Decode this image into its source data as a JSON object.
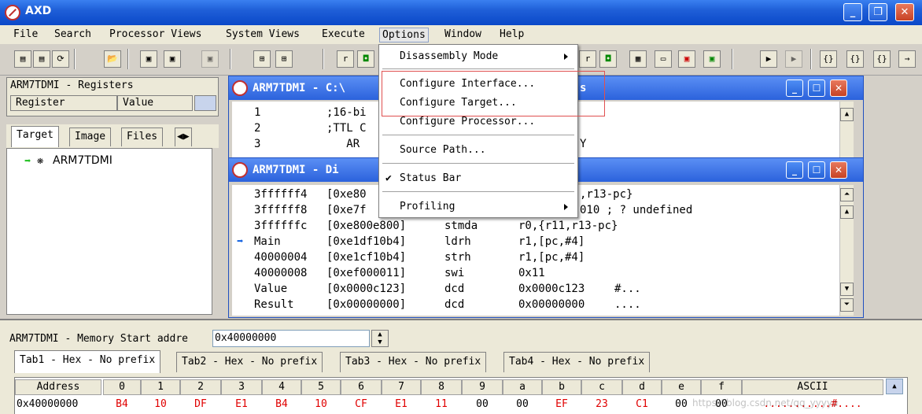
{
  "app": {
    "title": "AXD"
  },
  "menu": {
    "items": [
      "File",
      "Search",
      "Processor Views",
      "System Views",
      "Execute",
      "Options",
      "Window",
      "Help"
    ]
  },
  "registers": {
    "title": "ARM7TDMI - Registers",
    "col_register": "Register",
    "col_value": "Value"
  },
  "left_tabs": [
    "Target",
    "Image",
    "Files"
  ],
  "tree": {
    "root": "ARM7TDMI"
  },
  "source_window": {
    "title": "ARM7TDMI - C:\\",
    "title_tail": "s",
    "lines": [
      {
        "num": "1",
        "text": ";16-bi"
      },
      {
        "num": "2",
        "text": ";TTL C"
      },
      {
        "num": "3",
        "text": "   AR"
      }
    ],
    "tail": "Y"
  },
  "disasm_window": {
    "title": "ARM7TDMI - Di",
    "rows": [
      {
        "addr": "3ffffff4",
        "hex": "[0xe80",
        "op": "",
        "args": "",
        "tail": ",r13-pc}"
      },
      {
        "addr": "3ffffff8",
        "hex": "[0xe7f",
        "op": "",
        "args": "",
        "tail": "010 ; ? undefined"
      },
      {
        "addr": "3ffffffc",
        "hex": "[0xe800e800]",
        "op": "stmda",
        "args": "r0,{r11,r13-pc}",
        "tail": ""
      },
      {
        "addr": "Main",
        "hex": "[0xe1df10b4]",
        "op": "ldrh",
        "args": "r1,[pc,#4]",
        "tail": ""
      },
      {
        "addr": "40000004",
        "hex": "[0xe1cf10b4]",
        "op": "strh",
        "args": "r1,[pc,#4]",
        "tail": ""
      },
      {
        "addr": "40000008",
        "hex": "[0xef000011]",
        "op": "swi",
        "args": "0x11",
        "tail": ""
      },
      {
        "addr": "Value",
        "hex": "[0x0000c123]",
        "op": "dcd",
        "args": "0x0000c123",
        "tail": "#..."
      },
      {
        "addr": "Result",
        "hex": "[0x00000000]",
        "op": "dcd",
        "args": "0x00000000",
        "tail": "...."
      }
    ]
  },
  "options_menu": {
    "items": [
      {
        "label": "Disassembly Mode",
        "submenu": true,
        "checked": false
      },
      {
        "label": "Configure Interface...",
        "submenu": false,
        "checked": false
      },
      {
        "label": "Configure Target...",
        "submenu": false,
        "checked": false
      },
      {
        "label": "Configure Processor...",
        "submenu": false,
        "checked": false
      },
      {
        "label": "Source Path...",
        "submenu": false,
        "checked": false
      },
      {
        "label": "Status Bar",
        "submenu": false,
        "checked": true
      },
      {
        "label": "Profiling",
        "submenu": true,
        "checked": false
      }
    ],
    "check_glyph": "✔"
  },
  "memory": {
    "title": "ARM7TDMI - Memory  Start addre",
    "start_address": "0x40000000",
    "tabs": [
      "Tab1 - Hex - No prefix",
      "Tab2 - Hex - No prefix",
      "Tab3 - Hex - No prefix",
      "Tab4 - Hex - No prefix"
    ],
    "headers": [
      "Address",
      "0",
      "1",
      "2",
      "3",
      "4",
      "5",
      "6",
      "7",
      "8",
      "9",
      "a",
      "b",
      "c",
      "d",
      "e",
      "f",
      "ASCII"
    ],
    "row": {
      "address": "0x40000000",
      "bytes": [
        "B4",
        "10",
        "DF",
        "E1",
        "B4",
        "10",
        "CF",
        "E1",
        "11",
        "00",
        "00",
        "EF",
        "23",
        "C1",
        "00",
        "00"
      ],
      "ascii": "...........#...."
    }
  },
  "watermark": "https://blog.csdn.net/qq_yyyya"
}
